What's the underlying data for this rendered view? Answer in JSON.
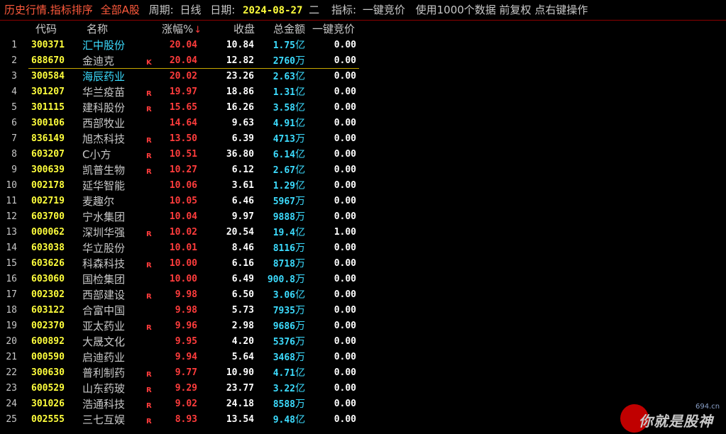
{
  "titlebar": {
    "context": "历史行情.指标排序",
    "market": "全部A股",
    "period_label": "周期:",
    "period_value": "日线",
    "date_label": "日期:",
    "date_value": "2024-08-27",
    "weekday": "二",
    "indicator_label": "指标:",
    "indicator_value": "一键竞价",
    "info": "使用1000个数据 前复权 点右键操作"
  },
  "columns": {
    "code": "代码",
    "name": "名称",
    "change": "涨幅%",
    "sort_arrow": "↓",
    "close": "收盘",
    "amount": "总金额",
    "auction": "一键竞价"
  },
  "colors": {
    "background": "#000000",
    "code": "#ffff3c",
    "up": "#ff3c3c",
    "amount": "#3cdcff",
    "name_highlight": "#3cdcff",
    "name_default": "#c8c8c8",
    "title_accent": "#ff5a3c"
  },
  "selected_row": 2,
  "rows": [
    {
      "idx": "1",
      "code": "300371",
      "name": "汇中股份",
      "name_color": "blue",
      "mark": "",
      "change": "20.04",
      "close": "10.84",
      "amount": "1.75",
      "unit": "亿",
      "auction": "0.00"
    },
    {
      "idx": "2",
      "code": "688670",
      "name": "金迪克",
      "name_color": "gray",
      "mark": "K",
      "change": "20.04",
      "close": "12.82",
      "amount": "2760",
      "unit": "万",
      "auction": "0.00"
    },
    {
      "idx": "3",
      "code": "300584",
      "name": "海辰药业",
      "name_color": "blue",
      "mark": "",
      "change": "20.02",
      "close": "23.26",
      "amount": "2.63",
      "unit": "亿",
      "auction": "0.00"
    },
    {
      "idx": "4",
      "code": "301207",
      "name": "华兰疫苗",
      "name_color": "gray",
      "mark": "R",
      "change": "19.97",
      "close": "18.86",
      "amount": "1.31",
      "unit": "亿",
      "auction": "0.00"
    },
    {
      "idx": "5",
      "code": "301115",
      "name": "建科股份",
      "name_color": "gray",
      "mark": "R",
      "change": "15.65",
      "close": "16.26",
      "amount": "3.58",
      "unit": "亿",
      "auction": "0.00"
    },
    {
      "idx": "6",
      "code": "300106",
      "name": "西部牧业",
      "name_color": "gray",
      "mark": "",
      "change": "14.64",
      "close": "9.63",
      "amount": "4.91",
      "unit": "亿",
      "auction": "0.00"
    },
    {
      "idx": "7",
      "code": "836149",
      "name": "旭杰科技",
      "name_color": "gray",
      "mark": "R",
      "change": "13.50",
      "close": "6.39",
      "amount": "4713",
      "unit": "万",
      "auction": "0.00"
    },
    {
      "idx": "8",
      "code": "603207",
      "name": "C小方",
      "name_color": "gray",
      "mark": "R",
      "change": "10.51",
      "close": "36.80",
      "amount": "6.14",
      "unit": "亿",
      "auction": "0.00"
    },
    {
      "idx": "9",
      "code": "300639",
      "name": "凯普生物",
      "name_color": "gray",
      "mark": "R",
      "change": "10.27",
      "close": "6.12",
      "amount": "2.67",
      "unit": "亿",
      "auction": "0.00"
    },
    {
      "idx": "10",
      "code": "002178",
      "name": "延华智能",
      "name_color": "gray",
      "mark": "",
      "change": "10.06",
      "close": "3.61",
      "amount": "1.29",
      "unit": "亿",
      "auction": "0.00"
    },
    {
      "idx": "11",
      "code": "002719",
      "name": "麦趣尔",
      "name_color": "gray",
      "mark": "",
      "change": "10.05",
      "close": "6.46",
      "amount": "5967",
      "unit": "万",
      "auction": "0.00"
    },
    {
      "idx": "12",
      "code": "603700",
      "name": "宁水集团",
      "name_color": "gray",
      "mark": "",
      "change": "10.04",
      "close": "9.97",
      "amount": "9888",
      "unit": "万",
      "auction": "0.00"
    },
    {
      "idx": "13",
      "code": "000062",
      "name": "深圳华强",
      "name_color": "gray",
      "mark": "R",
      "change": "10.02",
      "close": "20.54",
      "amount": "19.4",
      "unit": "亿",
      "auction": "1.00"
    },
    {
      "idx": "14",
      "code": "603038",
      "name": "华立股份",
      "name_color": "gray",
      "mark": "",
      "change": "10.01",
      "close": "8.46",
      "amount": "8116",
      "unit": "万",
      "auction": "0.00"
    },
    {
      "idx": "15",
      "code": "603626",
      "name": "科森科技",
      "name_color": "gray",
      "mark": "R",
      "change": "10.00",
      "close": "6.16",
      "amount": "8718",
      "unit": "万",
      "auction": "0.00"
    },
    {
      "idx": "16",
      "code": "603060",
      "name": "国检集团",
      "name_color": "gray",
      "mark": "",
      "change": "10.00",
      "close": "6.49",
      "amount": "900.8",
      "unit": "万",
      "auction": "0.00"
    },
    {
      "idx": "17",
      "code": "002302",
      "name": "西部建设",
      "name_color": "gray",
      "mark": "R",
      "change": "9.98",
      "close": "6.50",
      "amount": "3.06",
      "unit": "亿",
      "auction": "0.00"
    },
    {
      "idx": "18",
      "code": "603122",
      "name": "合富中国",
      "name_color": "gray",
      "mark": "",
      "change": "9.98",
      "close": "5.73",
      "amount": "7935",
      "unit": "万",
      "auction": "0.00"
    },
    {
      "idx": "19",
      "code": "002370",
      "name": "亚太药业",
      "name_color": "gray",
      "mark": "R",
      "change": "9.96",
      "close": "2.98",
      "amount": "9686",
      "unit": "万",
      "auction": "0.00"
    },
    {
      "idx": "20",
      "code": "600892",
      "name": "大晟文化",
      "name_color": "gray",
      "mark": "",
      "change": "9.95",
      "close": "4.20",
      "amount": "5376",
      "unit": "万",
      "auction": "0.00"
    },
    {
      "idx": "21",
      "code": "000590",
      "name": "启迪药业",
      "name_color": "gray",
      "mark": "",
      "change": "9.94",
      "close": "5.64",
      "amount": "3468",
      "unit": "万",
      "auction": "0.00"
    },
    {
      "idx": "22",
      "code": "300630",
      "name": "普利制药",
      "name_color": "gray",
      "mark": "R",
      "change": "9.77",
      "close": "10.90",
      "amount": "4.71",
      "unit": "亿",
      "auction": "0.00"
    },
    {
      "idx": "23",
      "code": "600529",
      "name": "山东药玻",
      "name_color": "gray",
      "mark": "R",
      "change": "9.29",
      "close": "23.77",
      "amount": "3.22",
      "unit": "亿",
      "auction": "0.00"
    },
    {
      "idx": "24",
      "code": "301026",
      "name": "浩通科技",
      "name_color": "gray",
      "mark": "R",
      "change": "9.02",
      "close": "24.18",
      "amount": "8588",
      "unit": "万",
      "auction": "0.00"
    },
    {
      "idx": "25",
      "code": "002555",
      "name": "三七互娱",
      "name_color": "gray",
      "mark": "R",
      "change": "8.93",
      "close": "13.54",
      "amount": "9.48",
      "unit": "亿",
      "auction": "0.00"
    }
  ],
  "watermark": {
    "text": "你就是股神",
    "small": "694.cn"
  }
}
